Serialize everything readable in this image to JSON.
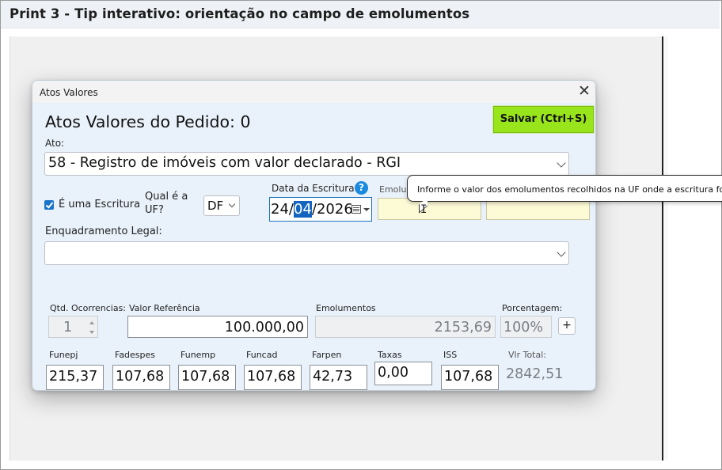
{
  "page": {
    "title": "Print 3 - Tip interativo: orientação no campo de emolumentos"
  },
  "window": {
    "title": "Atos Valores",
    "heading": "Atos Valores do Pedido: 0",
    "save_label": "Salvar (Ctrl+S)",
    "ato": {
      "label": "Ato:",
      "value": "58 - Registro de imóveis com valor declarado - RGI"
    },
    "escritura": {
      "label": "É uma Escritura",
      "checked": true
    },
    "uf": {
      "label_line1": "Qual é a",
      "label_line2": "UF?",
      "value": "DF"
    },
    "data_escritura": {
      "label": "Data da Escritura",
      "day": "24",
      "sep1": "/",
      "month": "04",
      "sep2": "/",
      "year": "2026"
    },
    "emolumentos_label_partial": "Emolum",
    "tooltip": "Informe o valor dos emolumentos recolhidos na UF onde a escritura fo",
    "enquadramento": {
      "label": "Enquadramento Legal:",
      "value": ""
    },
    "qtd": {
      "label": "Qtd. Ocorrencias:",
      "value": "1"
    },
    "valor_referencia": {
      "label": "Valor Referência",
      "value": "100.000,00"
    },
    "emolumentos": {
      "label": "Emolumentos",
      "value": "2153,69"
    },
    "porcentagem": {
      "label": "Porcentagem:",
      "value": "100%"
    },
    "plus_label": "+",
    "fees": [
      {
        "label": "Funepj",
        "value": "215,37"
      },
      {
        "label": "Fadespes",
        "value": "107,68"
      },
      {
        "label": "Funemp",
        "value": "107,68"
      },
      {
        "label": "Funcad",
        "value": "107,68"
      },
      {
        "label": "Farpen",
        "value": "42,73"
      },
      {
        "label": "Taxas",
        "value": "0,00"
      },
      {
        "label": "ISS",
        "value": "107,68"
      }
    ],
    "vlr_total": {
      "label": "Vlr Total:",
      "value": "2842,51"
    }
  },
  "colors": {
    "save_button": "#99e51c",
    "window_bg": "#e9f2fb",
    "yellow_field": "#fdfbd6",
    "accent_blue": "#1a73c8"
  },
  "icons": [
    "checkbox-icon",
    "help-icon",
    "calendar-icon",
    "close-icon",
    "chevron-down-icon",
    "text-cursor-icon"
  ]
}
